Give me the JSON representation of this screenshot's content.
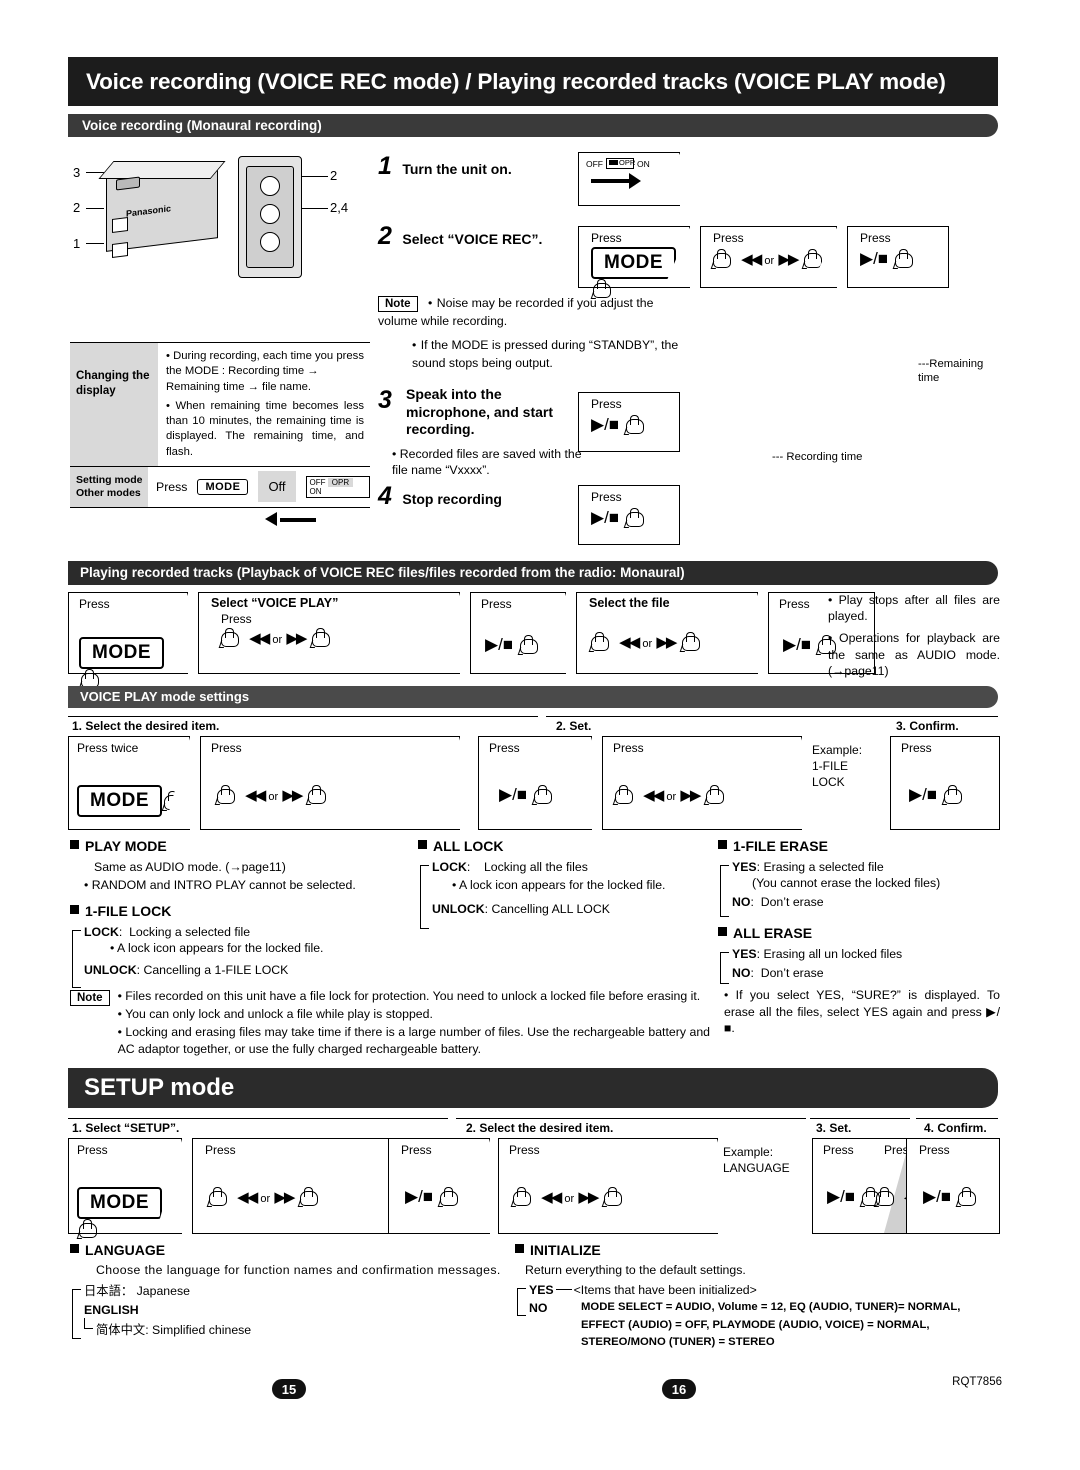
{
  "header": {
    "title": "Voice recording (VOICE REC mode) / Playing recorded tracks (VOICE PLAY mode)",
    "subtitle": "Voice recording (Monaural recording)"
  },
  "device": {
    "brand": "Panasonic",
    "callouts_left": [
      "3",
      "2",
      "1"
    ],
    "callouts_right": [
      "2",
      "2,4"
    ]
  },
  "steps": {
    "s1": {
      "num": "1",
      "label": "Turn the unit on."
    },
    "s2": {
      "num": "2",
      "label": "Select “VOICE REC”."
    },
    "s3": {
      "num": "3",
      "label": "Speak into the microphone, and start recording."
    },
    "s4": {
      "num": "4",
      "label": "Stop recording"
    }
  },
  "switch": {
    "off": "OFF",
    "opr": "OPR",
    "on": "ON"
  },
  "press_label": "Press",
  "keys": {
    "mode": "MODE",
    "prev": "◀◀",
    "next": "▶▶",
    "or": "or",
    "play_stop": "▶/■"
  },
  "note1": {
    "tag": "Note",
    "lines": [
      "Noise may be recorded if you adjust the volume while recording.",
      "If the MODE is pressed during “STANDBY”, the sound stops being output."
    ]
  },
  "changing_display": {
    "row_label": "Changing the display",
    "items": [
      "During recording, each time you press the MODE : Recording time → Remaining time → file name.",
      "When remaining time becomes less than 10 minutes, the remaining time is displayed. The remaining time,  and  flash."
    ],
    "setting_label": "Setting mode Other modes",
    "press": "Press",
    "mode": "MODE",
    "off": "Off"
  },
  "rec_notes": {
    "saved": "Recorded files are saved with the file name “Vxxxx”.",
    "remaining": "---Remaining time",
    "rec_time": "--- Recording time"
  },
  "play_section": {
    "title": "Playing recorded tracks (Playback of VOICE REC files/files recorded from the radio: Monaural)",
    "flow": [
      {
        "press": "Press",
        "caption": "",
        "key": "MODE"
      },
      {
        "press": "Press",
        "caption": "Select “VOICE PLAY”",
        "key": "prevnext"
      },
      {
        "press": "Press",
        "caption": "",
        "key": "play"
      },
      {
        "press": "Press",
        "caption": "Select the file",
        "key": "prevnext"
      },
      {
        "press": "Press",
        "caption": "",
        "key": "play"
      }
    ],
    "notes": [
      "Play stops after all files are played.",
      "Operations for playback are the same as AUDIO mode. (→page11)"
    ]
  },
  "voice_play_settings": {
    "title": "VOICE PLAY mode settings",
    "head1": "1. Select the desired item.",
    "head2": "2. Set.",
    "head3": "3. Confirm.",
    "press_twice": "Press twice",
    "press": "Press",
    "example": "Example:",
    "example_value": "1-FILE LOCK"
  },
  "settings_blocks": {
    "play_mode": {
      "title": "PLAY MODE",
      "lines": [
        "Same as AUDIO mode. (→page11)",
        "RANDOM and INTRO PLAY cannot be selected."
      ]
    },
    "file_lock": {
      "title": "1-FILE LOCK",
      "lock_label": "LOCK",
      "lock_text": "Locking a selected file",
      "lock_sub": "A lock icon      appears for the locked file.",
      "unlock_label": "UNLOCK",
      "unlock_text": "Cancelling a 1-FILE LOCK"
    },
    "all_lock": {
      "title": "ALL LOCK",
      "lock_label": "LOCK",
      "lock_text": "Locking all the files",
      "lock_sub": "A lock icon      appears for the locked file.",
      "unlock_label": "UNLOCK",
      "unlock_text": "Cancelling ALL LOCK"
    },
    "file_erase": {
      "title": "1-FILE ERASE",
      "yes_label": "YES",
      "yes_text": "Erasing a selected file",
      "yes_sub": "(You cannot erase the locked files)",
      "no_label": "NO",
      "no_text": "Don’t erase"
    },
    "all_erase": {
      "title": "ALL ERASE",
      "yes_label": "YES",
      "yes_text": "Erasing all un locked files",
      "no_label": "NO",
      "no_text": "Don’t erase",
      "note": "If you select YES, “SURE?” is displayed. To erase all the files, select YES again and press ▶/■."
    }
  },
  "note2": {
    "tag": "Note",
    "lines": [
      "Files recorded on this unit have a file lock for protection. You need to unlock a locked file before erasing it.",
      "You can only lock and unlock a file while play is stopped.",
      "Locking and erasing files may take time if there is a large number of files. Use the rechargeable battery and AC adaptor together, or use the fully charged rechargeable battery."
    ]
  },
  "setup": {
    "title": "SETUP mode",
    "head1": "1. Select “SETUP”.",
    "head2": "2. Select the desired item.",
    "head3": "3. Set.",
    "head4": "4. Confirm.",
    "press": "Press",
    "example": "Example:",
    "example_value": "LANGUAGE"
  },
  "language": {
    "title": "LANGUAGE",
    "text": "Choose the language for function names and confirmation messages.",
    "options": [
      {
        "label": "日本語：",
        "desc": "Japanese",
        "bold": false
      },
      {
        "label": "ENGLISH",
        "desc": "",
        "bold": true
      },
      {
        "label": "简体中文:",
        "desc": "Simplified chinese",
        "bold": false
      }
    ]
  },
  "initialize": {
    "title": "INITIALIZE",
    "text": "Return everything to the default settings.",
    "yes_label": "YES",
    "yes_text": "<Items that have been initialized>",
    "no_label": "NO",
    "detail": [
      "MODE SELECT = AUDIO, Volume = 12, EQ (AUDIO, TUNER)= NORMAL,",
      "EFFECT (AUDIO) = OFF,  PLAYMODE (AUDIO, VOICE) = NORMAL,",
      "STEREO/MONO (TUNER) = STEREO"
    ]
  },
  "footer": {
    "page_left": "15",
    "page_right": "16",
    "code": "RQT7856"
  }
}
